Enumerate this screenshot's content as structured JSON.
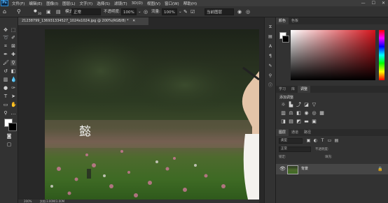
{
  "app": {
    "logo": "Ps"
  },
  "menubar": {
    "items": [
      "文件(F)",
      "编辑(E)",
      "图像(I)",
      "图层(L)",
      "文字(Y)",
      "选择(S)",
      "滤镜(T)",
      "3D(D)",
      "视图(V)",
      "窗口(W)",
      "帮助(H)"
    ],
    "win": {
      "min": "—",
      "max": "☐",
      "close": "✕"
    }
  },
  "options": {
    "mode_label": "模式:",
    "mode": "正常",
    "opacity_label": "不透明度:",
    "opacity": "100%",
    "flow_label": "流量:",
    "flow": "100%",
    "sample_value": "当前图层",
    "brush_size": "30"
  },
  "document": {
    "tab": "21238799_136931334527_1024x1024.jpg @ 200%(RGB/8) *",
    "close": "✕",
    "zoom": "200%",
    "docinfo": "文档:3.00M/3.00M",
    "watermark": "懿"
  },
  "panels": {
    "color_tabs": [
      "颜色",
      "色板"
    ],
    "adjust_tabs": [
      "学习",
      "库",
      "调整"
    ],
    "adjust_title": "添加调整",
    "layer_tabs": [
      "图层",
      "通道",
      "路径"
    ],
    "filter_kind": "类型",
    "blend": "正常",
    "opacity_label": "不透明度:",
    "lock_label": "锁定:",
    "fill_label": "填充:",
    "layer_name": "背景"
  }
}
